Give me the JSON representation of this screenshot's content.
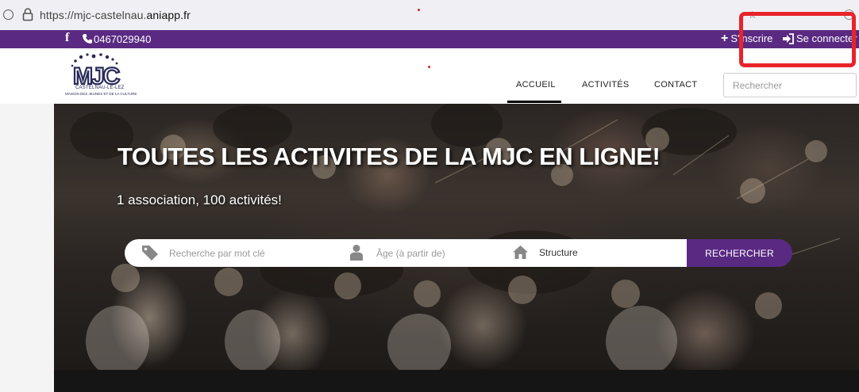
{
  "browser": {
    "url_prefix": "https://mjc-castelnau.",
    "url_domain": "aniapp.fr"
  },
  "topbar": {
    "facebook_icon": "f",
    "phone": "0467029940",
    "signup_label": "S'inscrire",
    "login_label": "Se connecter"
  },
  "header": {
    "logo": {
      "line1": "CASTELNAU-LE-LEZ",
      "line2": "MAISON DES JEUNES ET DE LA CULTURE"
    },
    "nav": {
      "accueil": "ACCUEIL",
      "activites": "ACTIVITÉS",
      "contact": "CONTACT"
    },
    "search_placeholder": "Rechercher"
  },
  "hero": {
    "title": "TOUTES LES ACTIVITES DE LA MJC EN LIGNE!",
    "subtitle": "1 association, 100 activités!"
  },
  "search_form": {
    "keyword_placeholder": "Recherche par mot clé",
    "age_placeholder": "Âge (à partir de)",
    "structure_label": "Structure",
    "submit_label": "RECHERCHER"
  },
  "colors": {
    "brand_purple": "#5a2a82",
    "annotation_red": "#e8242a"
  },
  "icons": {
    "tag": "tag-icon",
    "person": "person-icon",
    "home": "home-icon",
    "phone": "phone-icon",
    "plus": "plus-icon",
    "login": "login-icon",
    "lock": "lock-icon",
    "facebook": "facebook-icon"
  }
}
